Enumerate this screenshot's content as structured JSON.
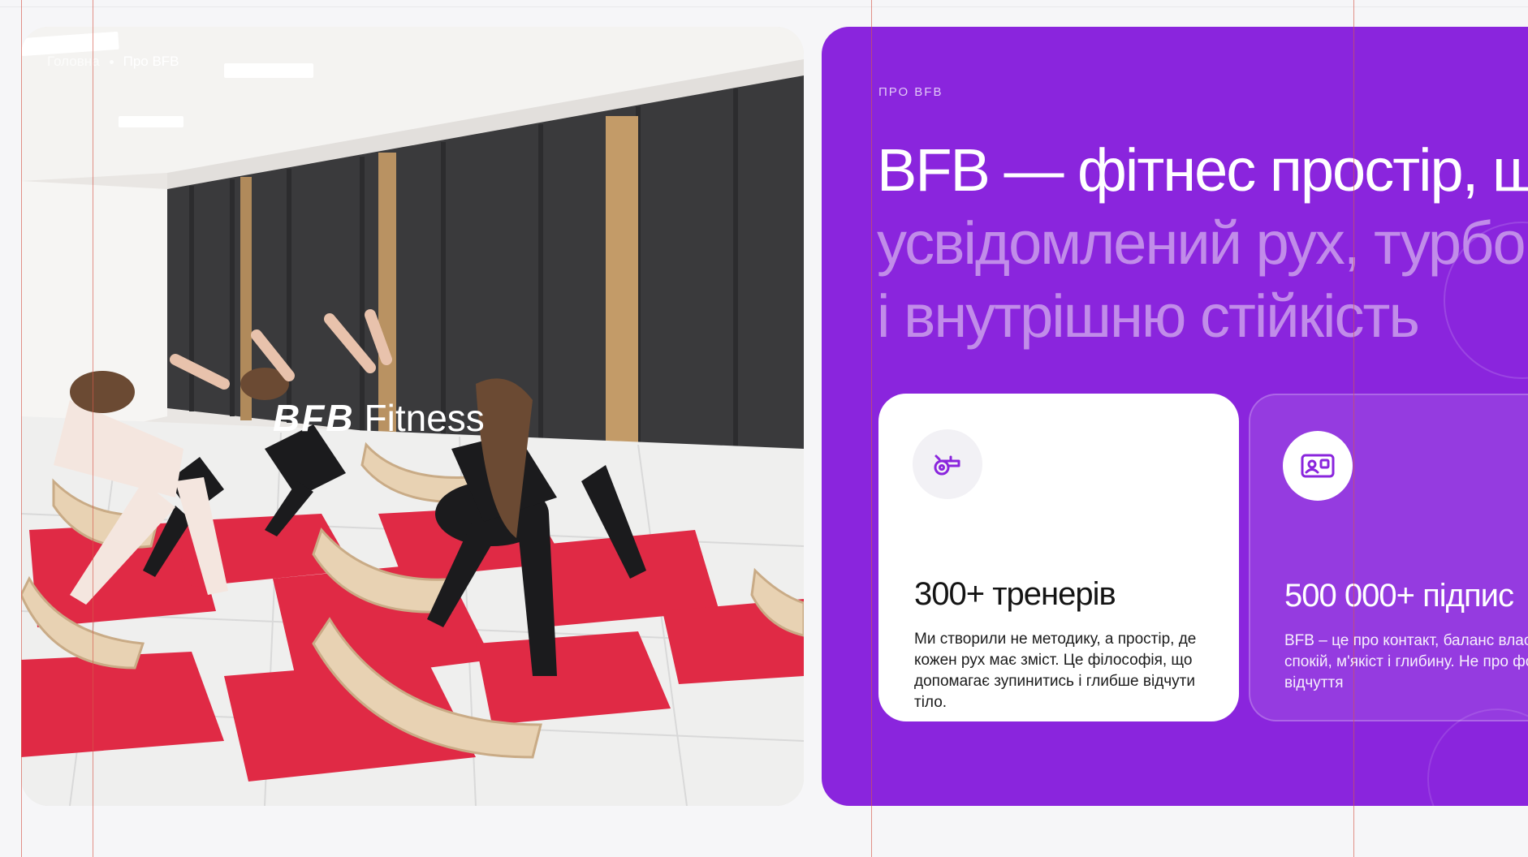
{
  "breadcrumb": {
    "home": "Головна",
    "current": "Про BFB"
  },
  "hero_logo": {
    "brand": "BFB",
    "suffix": "Fitness"
  },
  "about": {
    "eyebrow": "ПРО BFB",
    "headline_main": "BFB — фітнес простір, що",
    "headline_line2": "усвідомлений рух, турбо",
    "headline_line3": "і внутрішню стійкість"
  },
  "cards": [
    {
      "icon": "whistle-icon",
      "title": "300+ тренерів",
      "text": "Ми створили не методику, а простір, де кожен рух має зміст. Це філософія, що допомагає зупинитись і глибше відчути тіло."
    },
    {
      "icon": "id-card-icon",
      "title": "500 000+ підпис",
      "text": "BFB – це про контакт, баланс власний ритм, спокій, м'якіст і глибину. Не про форму, а про відчуття"
    }
  ],
  "colors": {
    "accent_purple": "#8a25dd",
    "headline_secondary": "#c18ce9",
    "card_white": "#ffffff",
    "mat_red": "#e02a45"
  }
}
